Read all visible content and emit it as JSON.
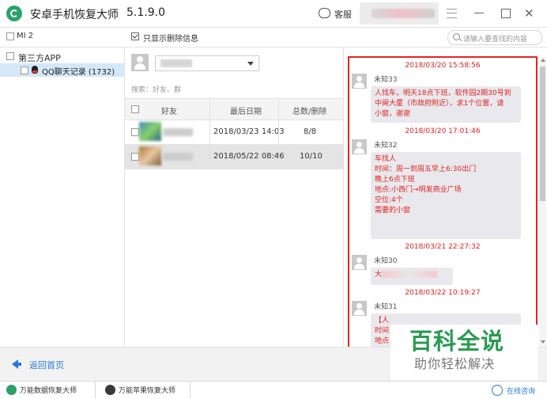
{
  "app": {
    "title": "安卓手机恢复大师",
    "version": "5.1.9.0",
    "support_label": "客服"
  },
  "colors": {
    "accent": "#2a7ad5",
    "brand": "#29a36a",
    "message_red": "#e02020",
    "highlight_border": "#e32424",
    "watermark_green": "#2b9a52"
  },
  "toolbar": {
    "device": "MI 2",
    "show_deleted_only": "只显示删除信息",
    "show_deleted_checked": true,
    "search_placeholder": "请输入要查找的内容"
  },
  "tree": {
    "root_label": "第三方APP",
    "items": [
      {
        "label": "QQ聊天记录 (1732)",
        "selected": true
      }
    ]
  },
  "friends": {
    "search_placeholder": "搜索：好友、群",
    "columns": [
      "好友",
      "最后日期",
      "总数/删除"
    ],
    "rows": [
      {
        "last_date": "2018/03/23 14:03",
        "count": "8/8"
      },
      {
        "last_date": "2018/05/22 08:46",
        "count": "10/10"
      }
    ]
  },
  "chat": {
    "messages": [
      {
        "time": "2018/03/20 15:58:56",
        "sender": "未知33",
        "lines": [
          "人找车，明天18点下班，软件园2期30号到",
          "中闽大厦（市政府附近），求1个位置，请",
          "小窗，谢谢"
        ]
      },
      {
        "time": "2018/03/20 17:01:46",
        "sender": "未知32",
        "lines": [
          "车找人",
          "时间：周一到周五早上6:30出门",
          "晚上6点下班",
          "地点:小西门→明发商业广场",
          "空位:4个",
          "需要的小窗"
        ]
      },
      {
        "time": "2018/03/21 22:27:32",
        "sender": "未知30",
        "lines": [
          "大"
        ]
      },
      {
        "time": "2018/03/22 10:19:27",
        "sender": "未知31",
        "lines": [
          "【人",
          "时间",
          "地点"
        ]
      }
    ]
  },
  "bottom": {
    "back_label": "返回首页"
  },
  "watermark": {
    "main": "百科全说",
    "sub": "助你轻松解决"
  },
  "footer": {
    "tabs": [
      "万能数据恢复大师",
      "万能苹果恢复大师"
    ],
    "consult_label": "在线咨询"
  }
}
